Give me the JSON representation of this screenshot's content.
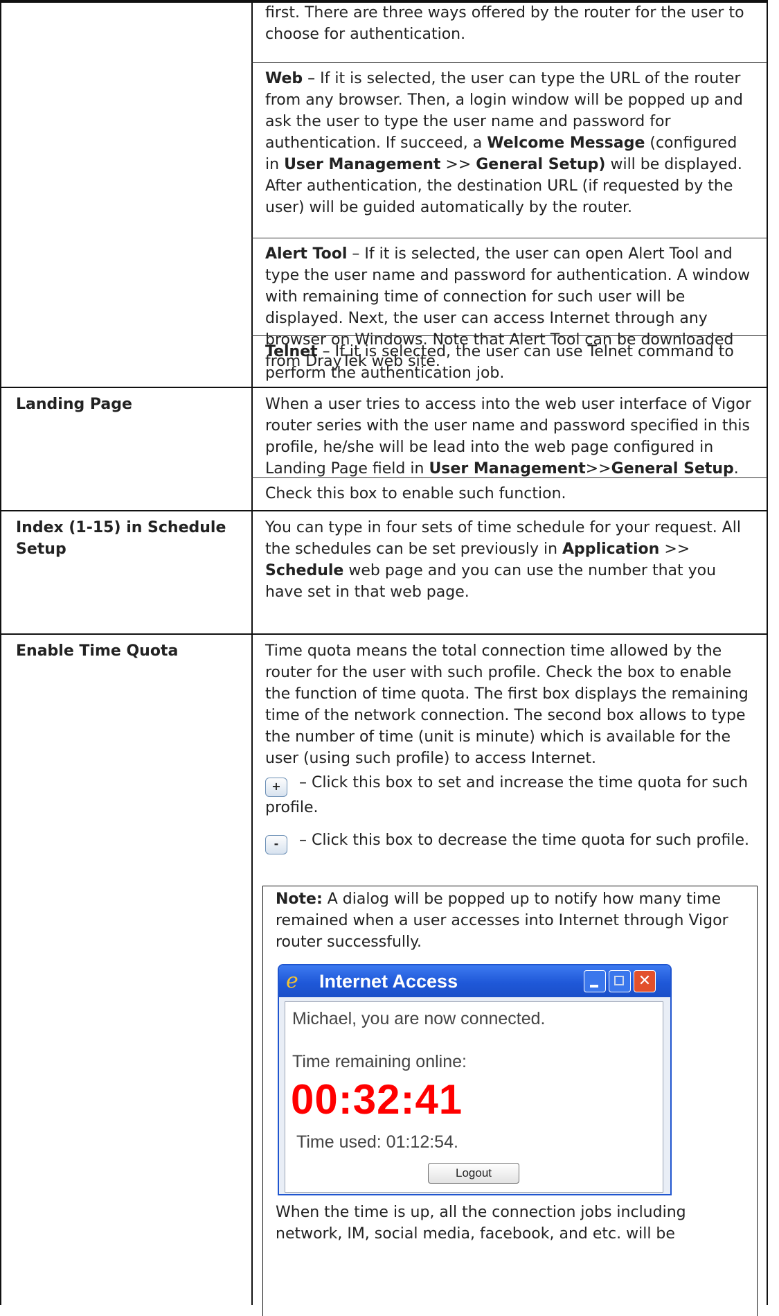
{
  "intro": {
    "text": "first. There are three ways offered by the router for the user to choose for authentication."
  },
  "web": {
    "term": "Web",
    "t1": " – If it is selected, the user can type the URL of the router from any browser. Then, a login window will be popped up and ask the user to type the user name and password for authentication. If succeed, a ",
    "b1": "Welcome Message",
    "t2": " (configured in ",
    "b2": "User Management",
    "t3": " >> ",
    "b3": "General Setup)",
    "t4": " will be displayed. After authentication, the destination URL (if requested by the user) will be guided automatically by the router."
  },
  "alert": {
    "term": "Alert Tool",
    "text": " – If it is selected, the user can open Alert Tool and type the user name and password for authentication. A window with remaining time of connection for such user will be displayed. Next, the user can access Internet through any browser on Windows. Note that Alert Tool can be downloaded from DrayTek web site."
  },
  "telnet": {
    "term": "Telnet",
    "text": " – If it is selected, the user can use Telnet command to perform the authentication job."
  },
  "landing": {
    "label": "Landing Page",
    "t1": "When a user tries to access into the web user interface of Vigor router series with the user name and password specified in this profile, he/she will be lead into the web page configured in Landing Page field in ",
    "b1": "User Management",
    "t2": ">>",
    "b2": "General Setup",
    "t3": ".",
    "check": "Check this box to enable such function."
  },
  "schedule": {
    "label": "Index (1-15) in Schedule Setup",
    "t1": "You can type in four sets of time schedule for your request. All the schedules can be set previously in ",
    "b1": "Application",
    "t2": " >> ",
    "b2": "Schedule",
    "t3": " web page and you can use the number that you have set in that web page."
  },
  "quota": {
    "label": "Enable Time Quota",
    "desc": "Time quota means the total connection time allowed by the router for the user with such profile. Check the box to enable the function of time quota. The first box displays the remaining time of the network connection. The second box allows to type the number of time (unit is minute) which is available for the user (using such profile) to access Internet.",
    "plus_symbol": "+",
    "plus_text": " – Click this box to set and increase the time quota for such profile.",
    "minus_symbol": "-",
    "minus_text": " – Click this box to decrease the time quota for such profile."
  },
  "note": {
    "label": "Note:",
    "text": " A dialog will be popped up to notify how many time remained when a user accesses into Internet through Vigor router successfully.",
    "after": "When the time is up, all the connection jobs including network, IM, social media, facebook, and etc. will be"
  },
  "dialog": {
    "title": "Internet Access",
    "connected": "Michael, you are now connected.",
    "remaining_label": "Time remaining online:",
    "remaining_value": "00:32:41",
    "used": "Time used: 01:12:54.",
    "logout": "Logout",
    "accent_color": "#ff0000",
    "title_bar_color": "#2a5fd6"
  }
}
